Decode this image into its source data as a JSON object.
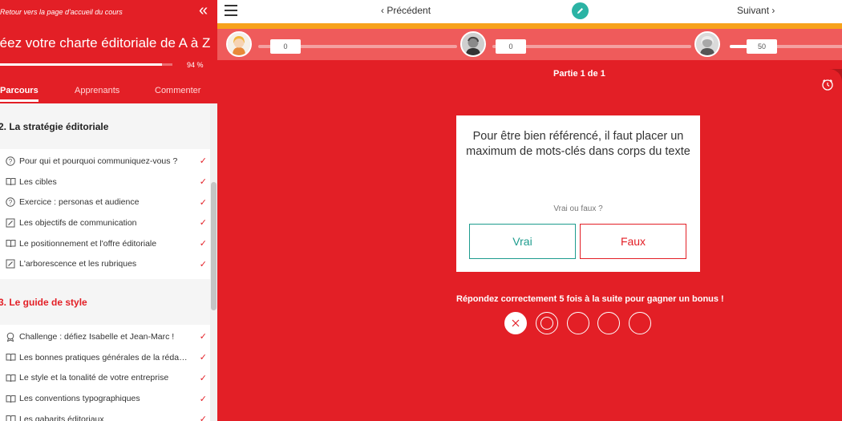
{
  "sidebar": {
    "back_link": "Retour vers la page d'accueil du cours",
    "collapse_icon": "double-chevron-left-icon",
    "course_title": "réez votre charte éditoriale de A à Z",
    "progress_percent": 94,
    "progress_label": "94 %",
    "tabs": [
      {
        "label": "Parcours",
        "active": true
      },
      {
        "label": "Apprenants",
        "active": false
      },
      {
        "label": "Commenter",
        "active": false
      }
    ],
    "sections": [
      {
        "title": "2. La stratégie éditoriale",
        "items": [
          {
            "icon": "question-circle-icon",
            "label": "Pour qui et pourquoi communiquez-vous ?",
            "done": true
          },
          {
            "icon": "book-icon",
            "label": "Les cibles",
            "done": true
          },
          {
            "icon": "question-circle-icon",
            "label": "Exercice : personas et audience",
            "done": true
          },
          {
            "icon": "edit-doc-icon",
            "label": "Les objectifs de communication",
            "done": true
          },
          {
            "icon": "book-icon",
            "label": "Le positionnement et l'offre éditoriale",
            "done": true
          },
          {
            "icon": "edit-doc-icon",
            "label": "L'arborescence et les rubriques",
            "done": true
          }
        ]
      },
      {
        "title": "3. Le guide de style",
        "items": [
          {
            "icon": "badge-icon",
            "label": "Challenge : défiez Isabelle et Jean-Marc !",
            "done": true
          },
          {
            "icon": "book-icon",
            "label": "Les bonnes pratiques générales de la rédacti...",
            "done": true
          },
          {
            "icon": "book-icon",
            "label": "Le style et la tonalité de votre entreprise",
            "done": true
          },
          {
            "icon": "book-icon",
            "label": "Les conventions typographiques",
            "done": true
          },
          {
            "icon": "book-icon",
            "label": "Les gabarits éditoriaux",
            "done": true
          }
        ]
      }
    ],
    "check_mark": "✓"
  },
  "topbar": {
    "menu_icon": "hamburger-icon",
    "prev_label": "‹ Précédent",
    "next_label": "Suivant ›",
    "edit_icon": "pencil-icon"
  },
  "players": [
    {
      "avatar": "player-1-avatar",
      "score": "0",
      "progress": 0
    },
    {
      "avatar": "player-2-avatar",
      "score": "0",
      "progress": 0
    },
    {
      "avatar": "player-3-avatar",
      "score": "50",
      "progress": 0.15
    }
  ],
  "quiz": {
    "part_label": "Partie 1 de 1",
    "question": "Pour être bien référencé, il faut placer un maximum de mots-clés dans corps du texte",
    "hint": "Vrai ou faux ?",
    "true_label": "Vrai",
    "false_label": "Faux",
    "bonus_text": "Répondez correctement 5 fois à la suite pour gagner un bonus !",
    "streak": [
      "wrong",
      "current",
      "empty",
      "empty",
      "empty"
    ]
  },
  "colors": {
    "brand_red": "#e31f26",
    "accent_orange": "#f7a21b",
    "teal": "#1e9c8e"
  }
}
